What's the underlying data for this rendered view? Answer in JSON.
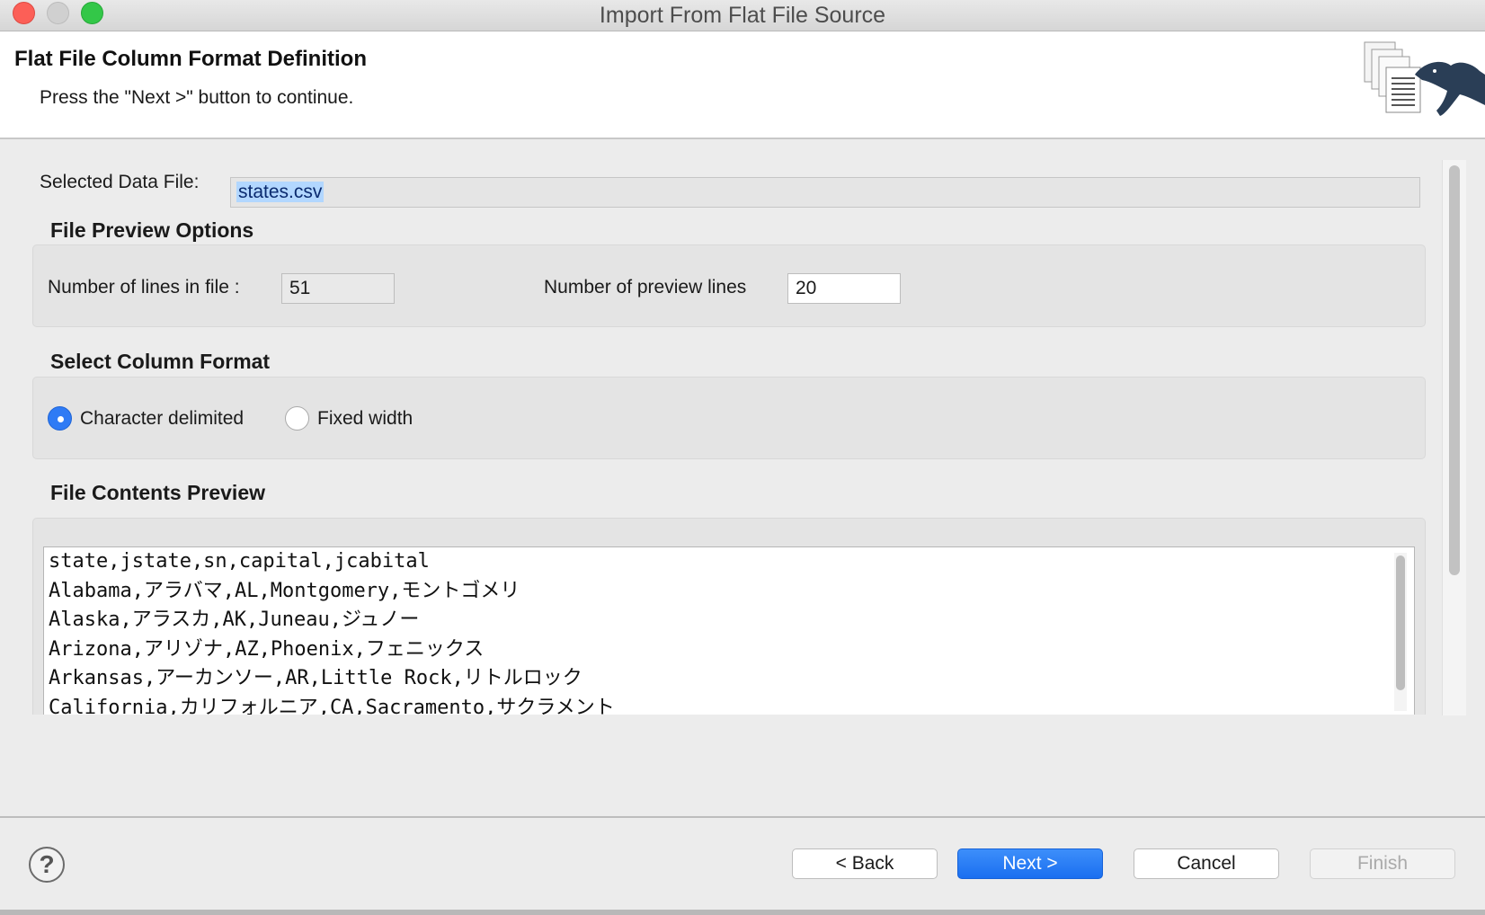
{
  "window": {
    "title": "Import From Flat File Source"
  },
  "banner": {
    "title": "Flat File Column Format Definition",
    "message": "Press the \"Next >\" button to continue."
  },
  "data_file": {
    "label": "Selected Data File:",
    "value": "states.csv"
  },
  "preview_options": {
    "title": "File Preview Options",
    "lines_label": "Number of lines in file :",
    "lines_value": "51",
    "preview_label": "Number of preview lines",
    "preview_value": "20"
  },
  "column_format": {
    "title": "Select Column Format",
    "options": [
      {
        "label": "Character delimited",
        "selected": true
      },
      {
        "label": "Fixed width",
        "selected": false
      }
    ]
  },
  "contents_preview": {
    "title": "File Contents Preview",
    "lines": [
      "state,jstate,sn,capital,jcabital",
      "Alabama,アラバマ,AL,Montgomery,モントゴメリ",
      "Alaska,アラスカ,AK,Juneau,ジュノー",
      "Arizona,アリゾナ,AZ,Phoenix,フェニックス",
      "Arkansas,アーカンソー,AR,Little Rock,リトルロック",
      "California,カリフォルニア,CA,Sacramento,サクラメント"
    ]
  },
  "footer": {
    "help_icon": "help-icon",
    "back": "< Back",
    "next": "Next >",
    "cancel": "Cancel",
    "finish": "Finish"
  },
  "colors": {
    "accent": "#2f7bf5",
    "primary_button": "#1a6ff0",
    "selection": "#b2d7ff"
  }
}
